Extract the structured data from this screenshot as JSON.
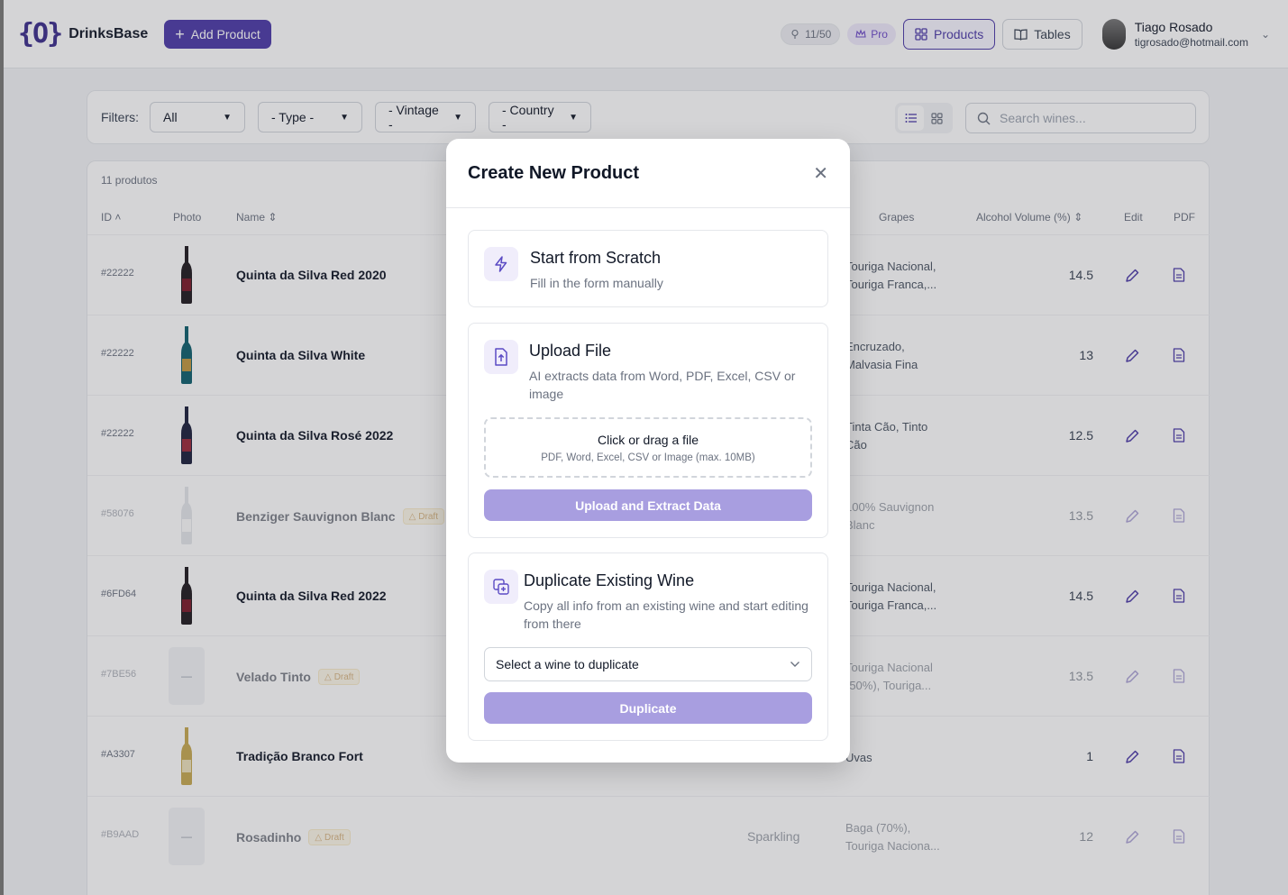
{
  "header": {
    "logo_mark": "{O}",
    "app_name": "DrinksBase",
    "add_product_label": "Add Product",
    "usage_count": "11/50",
    "plan_badge": "Pro",
    "nav": [
      {
        "label": "Products",
        "active": true,
        "icon": "grid-icon"
      },
      {
        "label": "Tables",
        "active": false,
        "icon": "book-icon"
      }
    ],
    "user": {
      "name": "Tiago Rosado",
      "email": "tigrosado@hotmail.com"
    }
  },
  "filters": {
    "label": "Filters:",
    "selects": [
      {
        "value": "All"
      },
      {
        "value": "- Type -"
      },
      {
        "value": "- Vintage -"
      },
      {
        "value": "- Country -"
      }
    ],
    "search_placeholder": "Search wines..."
  },
  "table": {
    "count_label": "11 produtos",
    "columns": {
      "id": "ID",
      "photo": "Photo",
      "name": "Name",
      "grapes": "Grapes",
      "alcohol": "Alcohol Volume (%)",
      "edit": "Edit",
      "pdf": "PDF"
    },
    "draft_label": "Draft",
    "rows": [
      {
        "id": "#22222",
        "name": "Quinta da Silva Red 2020",
        "type": "",
        "grapes_1": "Touriga Nacional,",
        "grapes_2": "Touriga Franca,...",
        "alcohol": "14.5",
        "draft": false,
        "bottle": "red"
      },
      {
        "id": "#22222",
        "name": "Quinta da Silva White",
        "type": "",
        "grapes_1": "Encruzado,",
        "grapes_2": "Malvasia Fina",
        "alcohol": "13",
        "draft": false,
        "bottle": "white"
      },
      {
        "id": "#22222",
        "name": "Quinta da Silva Rosé 2022",
        "type": "",
        "grapes_1": "Tinta Cão, Tinto",
        "grapes_2": "Cão",
        "alcohol": "12.5",
        "draft": false,
        "bottle": "rose"
      },
      {
        "id": "#58076",
        "name": "Benziger Sauvignon Blanc",
        "type": "",
        "grapes_1": "100% Sauvignon",
        "grapes_2": "Blanc",
        "alcohol": "13.5",
        "draft": true,
        "bottle": "clear"
      },
      {
        "id": "#6FD64",
        "name": "Quinta da Silva Red 2022",
        "type": "",
        "grapes_1": "Touriga Nacional,",
        "grapes_2": "Touriga Franca,...",
        "alcohol": "14.5",
        "draft": false,
        "bottle": "red"
      },
      {
        "id": "#7BE56",
        "name": "Velado Tinto",
        "type": "",
        "grapes_1": "Touriga Nacional",
        "grapes_2": "(50%), Touriga...",
        "alcohol": "13.5",
        "draft": true,
        "bottle": "none"
      },
      {
        "id": "#A3307",
        "name": "Tradição Branco Fort",
        "type": "",
        "grapes_1": "Uvas",
        "grapes_2": "",
        "alcohol": "1",
        "draft": false,
        "bottle": "gold"
      },
      {
        "id": "#B9AAD",
        "name": "Rosadinho",
        "type": "Sparkling",
        "grapes_1": "Baga (70%),",
        "grapes_2": "Touriga Naciona...",
        "alcohol": "12",
        "draft": true,
        "bottle": "none"
      }
    ]
  },
  "modal": {
    "title": "Create New Product",
    "scratch": {
      "title": "Start from Scratch",
      "desc": "Fill in the form manually"
    },
    "upload": {
      "title": "Upload File",
      "desc": "AI extracts data from Word, PDF, Excel, CSV or image",
      "drop_title": "Click or drag a file",
      "drop_sub": "PDF, Word, Excel, CSV or Image (max. 10MB)",
      "button": "Upload and Extract Data"
    },
    "duplicate": {
      "title": "Duplicate Existing Wine",
      "desc": "Copy all info from an existing wine and start editing from there",
      "select_placeholder": "Select a wine to duplicate",
      "button": "Duplicate"
    }
  },
  "colors": {
    "brand": "#4c3aa8",
    "button_disabled": "#a89ee0",
    "draft_badge": "#b7791f"
  }
}
